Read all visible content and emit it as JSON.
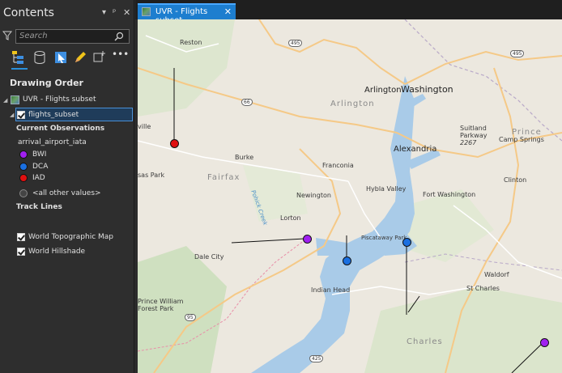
{
  "contents": {
    "title": "Contents",
    "search_placeholder": "Search",
    "drawing_order_title": "Drawing Order",
    "map_name": "UVR - Flights subset",
    "layer_name": "flights_subset",
    "current_observations": "Current Observations",
    "field_name": "arrival_airport_iata",
    "legend": [
      {
        "label": "BWI",
        "color": "#a020f0"
      },
      {
        "label": "DCA",
        "color": "#1a6fe0"
      },
      {
        "label": "IAD",
        "color": "#e01010"
      },
      {
        "label": "<all other values>",
        "color": "#444444"
      }
    ],
    "track_lines": "Track Lines",
    "basemaps": [
      "World Topographic Map",
      "World Hillshade"
    ]
  },
  "tab": {
    "label": "UVR - Flights subset"
  },
  "map": {
    "labels": {
      "reston": "Reston",
      "arlington": "Arlington",
      "washington": "Washington",
      "arlington_region": "Arlington",
      "suitland": "Suitland",
      "parkway": "Parkway",
      "parkway_code": "2267",
      "prince": "Prince",
      "camp_springs": "Camp Springs",
      "ville": "ville",
      "alexandria": "Alexandria",
      "burke": "Burke",
      "fairfax": "Fairfax",
      "franconia": "Franconia",
      "sas_park": "sas Park",
      "pohick_creek": "Pohick Creek",
      "hybla_valley": "Hybla Valley",
      "clinton": "Clinton",
      "newington": "Newington",
      "fort_washington": "Fort Washington",
      "lorton": "Lorton",
      "piscataway_park": "Piscataway Park",
      "dale_city": "Dale City",
      "waldorf": "Waldorf",
      "indian_head": "Indian Head",
      "st_charles": "St Charles",
      "prince_william": "Prince William",
      "forest_park": "Forest Park",
      "charles": "Charles"
    },
    "shields": [
      "495",
      "495",
      "66",
      "95",
      "425"
    ]
  }
}
